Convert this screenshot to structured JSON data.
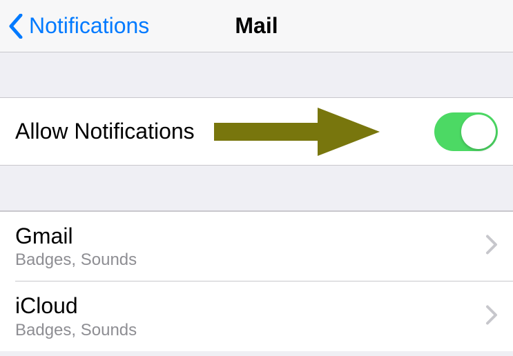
{
  "nav": {
    "back_label": "Notifications",
    "title": "Mail"
  },
  "allow_notifications": {
    "label": "Allow Notifications",
    "enabled": true
  },
  "colors": {
    "tint": "#007aff",
    "toggle_on": "#4cd964",
    "annotation_arrow": "#78760d"
  },
  "accounts": [
    {
      "name": "Gmail",
      "detail": "Badges, Sounds"
    },
    {
      "name": "iCloud",
      "detail": "Badges, Sounds"
    }
  ]
}
